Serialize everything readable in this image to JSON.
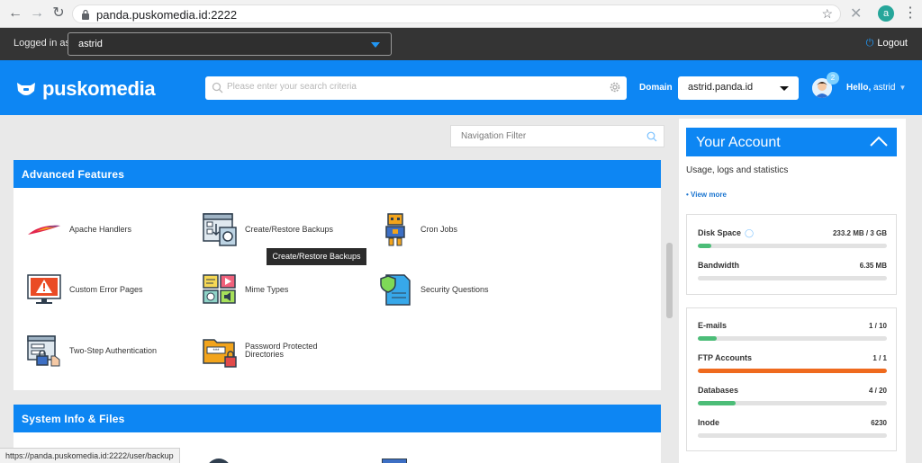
{
  "browser": {
    "url": "panda.puskomedia.id:2222",
    "profile_initial": "a",
    "status_url": "https://panda.puskomedia.id:2222/user/backup"
  },
  "admin_bar": {
    "logged_in_label": "Logged in as",
    "user": "astrid",
    "logout_label": "Logout"
  },
  "header": {
    "logo_text": "puskomedia",
    "search_placeholder": "Please enter your search criteria",
    "domain_label": "Domain",
    "domain_value": "astrid.panda.id",
    "notification_count": "2",
    "hello_label": "Hello,",
    "hello_user": "astrid"
  },
  "nav_filter_placeholder": "Navigation Filter",
  "advanced": {
    "title": "Advanced Features",
    "items": [
      {
        "label": "Apache Handlers",
        "icon": "feather-icon"
      },
      {
        "label": "Create/Restore Backups",
        "icon": "backup-icon"
      },
      {
        "label": "Cron Jobs",
        "icon": "robot-icon"
      },
      {
        "label": "Custom Error Pages",
        "icon": "error-page-icon"
      },
      {
        "label": "Mime Types",
        "icon": "media-types-icon"
      },
      {
        "label": "Security Questions",
        "icon": "shield-document-icon"
      },
      {
        "label": "Two-Step Authentication",
        "icon": "two-step-auth-icon"
      },
      {
        "label": "Password Protected Directories",
        "icon": "locked-folder-icon"
      }
    ]
  },
  "tooltip": "Create/Restore Backups",
  "system": {
    "title": "System Info & Files"
  },
  "account": {
    "title": "Your Account",
    "subtitle": "Usage, logs and statistics",
    "view_more": "• View more",
    "stats_a": [
      {
        "name": "Disk Space",
        "value": "233.2 MB / 3 GB",
        "fill": 0.07,
        "color": "#4cbd78"
      },
      {
        "name": "Bandwidth",
        "value": "6.35 MB",
        "fill": 0,
        "color": "#4cbd78"
      }
    ],
    "stats_b": [
      {
        "name": "E-mails",
        "value": "1 / 10",
        "fill": 0.1,
        "color": "#4cbd78"
      },
      {
        "name": "FTP Accounts",
        "value": "1 / 1",
        "fill": 1.0,
        "color": "#ef6a1e"
      },
      {
        "name": "Databases",
        "value": "4 / 20",
        "fill": 0.2,
        "color": "#4cbd78"
      },
      {
        "name": "Inode",
        "value": "6230",
        "fill": 0,
        "color": "#4cbd78"
      }
    ]
  }
}
